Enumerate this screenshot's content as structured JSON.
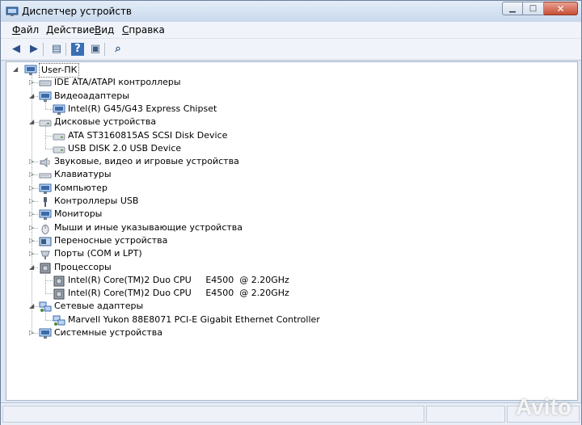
{
  "window": {
    "title": "Диспетчер устройств"
  },
  "menu": [
    {
      "text": "Файл",
      "u": "Ф",
      "rest": "айл"
    },
    {
      "text": "Действие",
      "u": "Д",
      "rest": "ействие"
    },
    {
      "text": "Вид",
      "u": "В",
      "rest": "ид"
    },
    {
      "text": "Справка",
      "u": "С",
      "rest": "правка"
    }
  ],
  "toolbar": [
    {
      "name": "back-icon",
      "glyph": "◀",
      "color": "#2d4f8a"
    },
    {
      "name": "forward-icon",
      "glyph": "▶",
      "color": "#2d4f8a"
    },
    {
      "name": "properties-icon",
      "glyph": "▤",
      "color": "#3b5b84"
    },
    {
      "name": "help-icon",
      "glyph": "?",
      "color": "#ffffff"
    },
    {
      "name": "show-hide-icon",
      "glyph": "▣",
      "color": "#3b5b84"
    },
    {
      "name": "scan-hardware-icon",
      "glyph": "⌕",
      "color": "#3b5b84"
    }
  ],
  "tree": {
    "root": "User-ПК",
    "items": [
      {
        "label": "IDE ATA/ATAPI контроллеры",
        "level": 1,
        "expanded": false,
        "icon": "ide-controller-icon",
        "color": "#6a7b8e"
      },
      {
        "label": "Видеоадаптеры",
        "level": 1,
        "expanded": true,
        "icon": "display-adapter-icon",
        "color": "#3b6aa8"
      },
      {
        "label": "Intel(R) G45/G43 Express Chipset",
        "level": 2,
        "icon": "display-adapter-icon",
        "color": "#3b6aa8"
      },
      {
        "label": "Дисковые устройства",
        "level": 1,
        "expanded": true,
        "icon": "disk-drive-icon",
        "color": "#8a96a4"
      },
      {
        "label": "ATA ST3160815AS SCSI Disk Device",
        "level": 2,
        "icon": "disk-drive-icon",
        "color": "#8a96a4"
      },
      {
        "label": "USB DISK 2.0 USB Device",
        "level": 2,
        "icon": "disk-drive-icon",
        "color": "#8a96a4"
      },
      {
        "label": "Звуковые, видео и игровые устройства",
        "level": 1,
        "expanded": false,
        "icon": "sound-device-icon",
        "color": "#6f7e8f"
      },
      {
        "label": "Клавиатуры",
        "level": 1,
        "expanded": false,
        "icon": "keyboard-icon",
        "color": "#7a8594"
      },
      {
        "label": "Компьютер",
        "level": 1,
        "expanded": false,
        "icon": "computer-icon",
        "color": "#3b6aa8"
      },
      {
        "label": "Контроллеры USB",
        "level": 1,
        "expanded": false,
        "icon": "usb-icon",
        "color": "#555f6b"
      },
      {
        "label": "Мониторы",
        "level": 1,
        "expanded": false,
        "icon": "monitor-icon",
        "color": "#3b6aa8"
      },
      {
        "label": "Мыши и иные указывающие устройства",
        "level": 1,
        "expanded": false,
        "icon": "mouse-icon",
        "color": "#7a8594"
      },
      {
        "label": "Переносные устройства",
        "level": 1,
        "expanded": false,
        "icon": "portable-device-icon",
        "color": "#3b5b84"
      },
      {
        "label": "Порты (COM и LPT)",
        "level": 1,
        "expanded": false,
        "icon": "port-icon",
        "color": "#6f7e8f"
      },
      {
        "label": "Процессоры",
        "level": 1,
        "expanded": true,
        "icon": "processor-icon",
        "color": "#5d6670"
      },
      {
        "label": "Intel(R) Core(TM)2 Duo CPU     E4500  @ 2.20GHz",
        "level": 2,
        "icon": "processor-icon",
        "color": "#5d6670"
      },
      {
        "label": "Intel(R) Core(TM)2 Duo CPU     E4500  @ 2.20GHz",
        "level": 2,
        "icon": "processor-icon",
        "color": "#5d6670"
      },
      {
        "label": "Сетевые адаптеры",
        "level": 1,
        "expanded": true,
        "icon": "network-adapter-icon",
        "color": "#3b6aa8"
      },
      {
        "label": "Marvell Yukon 88E8071 PCI-E Gigabit Ethernet Controller",
        "level": 2,
        "icon": "network-adapter-icon",
        "color": "#3b6aa8"
      },
      {
        "label": "Системные устройства",
        "level": 1,
        "expanded": false,
        "icon": "system-device-icon",
        "color": "#3b6aa8"
      }
    ]
  },
  "watermark": "Avito"
}
